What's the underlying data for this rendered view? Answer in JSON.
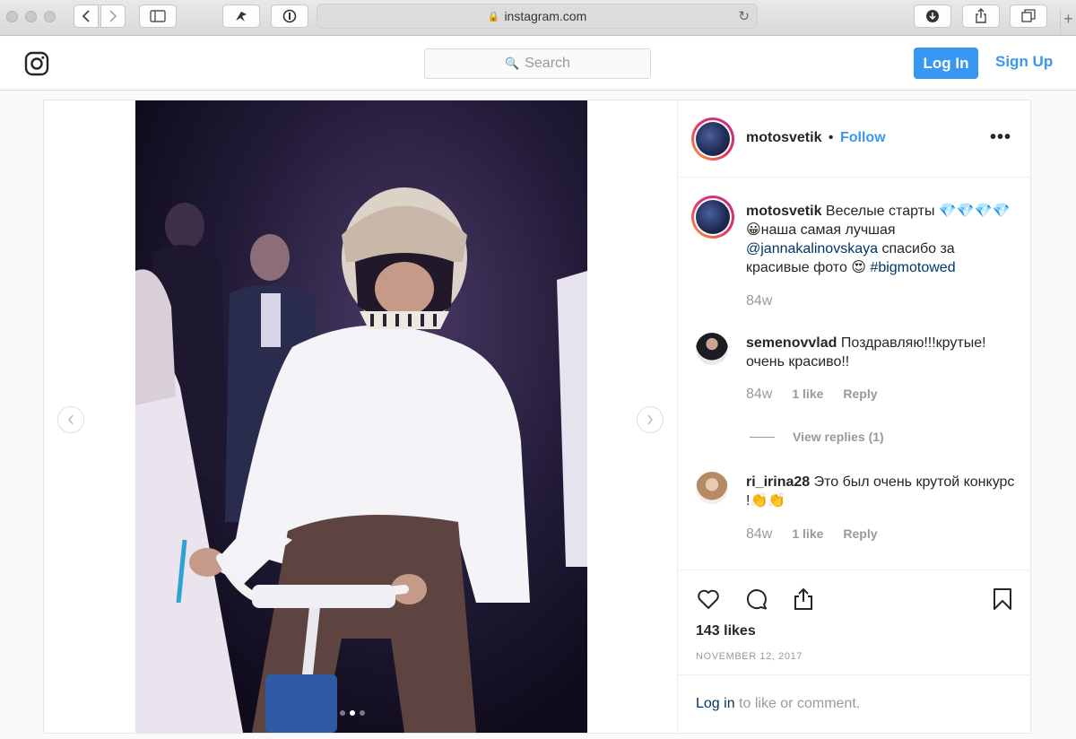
{
  "browser": {
    "url": "instagram.com"
  },
  "header": {
    "search_placeholder": "Search",
    "login_label": "Log In",
    "signup_label": "Sign Up"
  },
  "post": {
    "username": "motosvetik",
    "separator": "•",
    "follow_label": "Follow",
    "more_label": "•••",
    "caption": {
      "username": "motosvetik",
      "text_1": "Веселые старты 💎💎💎💎 😀наша самая лучшая",
      "mention": "@jannakalinovskaya",
      "text_2": "спасибо за красивые фото 😍",
      "hashtag": "#bigmotowed",
      "time": "84w"
    },
    "comments": [
      {
        "username": "semenovvlad",
        "text": "Поздравляю!!!крутые! очень красиво!!",
        "time": "84w",
        "likes": "1 like",
        "reply": "Reply"
      },
      {
        "username": "ri_irina28",
        "text": "Это был очень крутой конкурс !👏👏",
        "time": "84w",
        "likes": "1 like",
        "reply": "Reply"
      }
    ],
    "view_replies": "View replies (1)",
    "likes": "143 likes",
    "date": "NOVEMBER 12, 2017",
    "login_prompt": {
      "link": "Log in",
      "text": "to like or comment."
    },
    "carousel": {
      "total": 3,
      "active_index": 1
    }
  },
  "colors": {
    "brand_blue": "#3897f0",
    "link_dark": "#003569",
    "muted": "#999999"
  }
}
